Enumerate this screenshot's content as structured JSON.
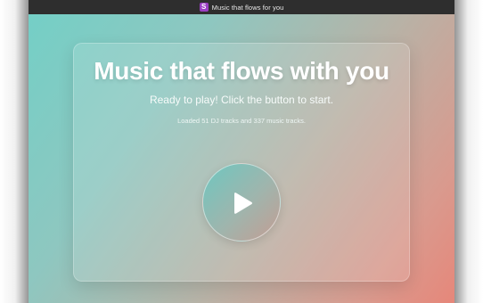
{
  "window": {
    "title": "Music that flows for you",
    "app_icon_letter": "S",
    "app_icon_color": "#9b3fc4"
  },
  "main": {
    "headline": "Music that flows with you",
    "status": "Ready to play! Click the button to start.",
    "loaded_text": "Loaded 51 DJ tracks and 337 music tracks.",
    "play_button": {
      "icon": "play-icon"
    }
  },
  "theme": {
    "gradient_start": "#74cfc6",
    "gradient_end": "#e6877a",
    "titlebar": "#2e2e2e"
  }
}
